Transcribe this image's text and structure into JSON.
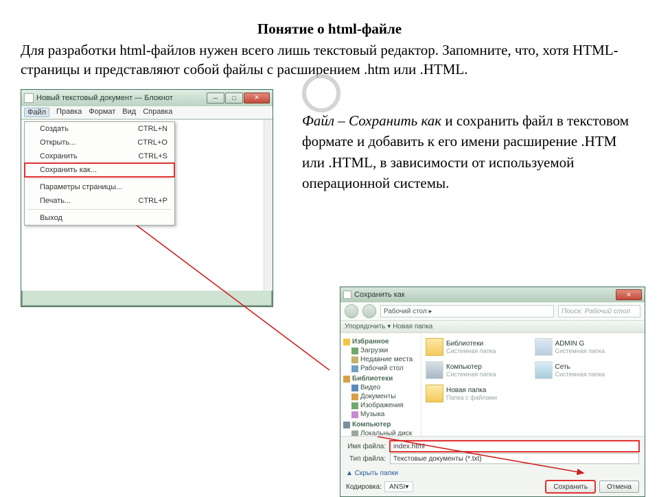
{
  "heading": "Понятие о html-файле",
  "intro": "Для разработки html-файлов нужен всего лишь текстовый редактор. Запомните, что, хотя HTML-страницы и представляют собой файлы с расширением .htm или .HTML.",
  "para2_prefix": "Файл – Сохранить как",
  "para2_rest": " и сохранить файл в текстовом формате и добавить к его имени расширение .HTM или .HTML, в зависимости от используемой операционной системы.",
  "notepad": {
    "title": "Новый текстовый документ — Блокнот",
    "menu": {
      "file": "Файл",
      "edit": "Правка",
      "format": "Формат",
      "view": "Вид",
      "help": "Справка"
    },
    "items": {
      "create": "Создать",
      "create_sc": "CTRL+N",
      "open": "Открыть...",
      "open_sc": "CTRL+O",
      "save": "Сохранить",
      "save_sc": "CTRL+S",
      "saveas": "Сохранить как...",
      "pagesetup": "Параметры страницы...",
      "print": "Печать...",
      "print_sc": "CTRL+P",
      "exit": "Выход"
    }
  },
  "savedlg": {
    "title": "Сохранить как",
    "breadcrumb": "Рабочий стол  ▸",
    "search_ph": "Поиск: Рабочий стол",
    "toolbar": "Упорядочить ▾    Новая папка",
    "nav": {
      "favorites": "Избранное",
      "downloads": "Загрузки",
      "recent": "Недавние места",
      "desktop": "Рабочий стол",
      "libraries": "Библиотеки",
      "video": "Видео",
      "documents": "Документы",
      "images": "Изображения",
      "music": "Музыка",
      "computer": "Компьютер",
      "localdisk": "Локальный диск"
    },
    "items": {
      "lib": "Библиотеки",
      "lib_sub": "Системная папка",
      "user": "ADMIN G",
      "user_sub": "Системная папка",
      "comp": "Компьютер",
      "comp_sub": "Системная папка",
      "net": "Сеть",
      "net_sub": "Системная папка",
      "folder": "Новая папка",
      "folder_sub": "Папка с файлами"
    },
    "filename_label": "Имя файла:",
    "filename_value": "index.html",
    "filetype_label": "Тип файла:",
    "filetype_value": "Текстовые документы (*.txt)",
    "hide": "Скрыть папки",
    "encoding_label": "Кодировка:",
    "encoding_value": "ANSI",
    "save_btn": "Сохранить",
    "cancel_btn": "Отмена"
  }
}
